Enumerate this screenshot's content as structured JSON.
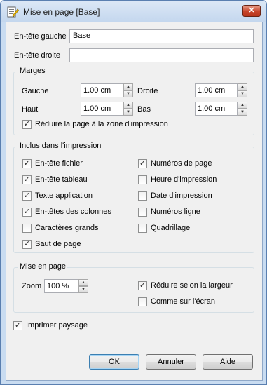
{
  "window": {
    "title": "Mise en page [Base]",
    "close_label": "✕"
  },
  "header": {
    "left_label": "En-tête gauche",
    "left_value": "Base",
    "right_label": "En-tête droite",
    "right_value": ""
  },
  "margins": {
    "title": "Marges",
    "left_label": "Gauche",
    "left_value": "1.00 cm",
    "right_label": "Droite",
    "right_value": "1.00 cm",
    "top_label": "Haut",
    "top_value": "1.00 cm",
    "bottom_label": "Bas",
    "bottom_value": "1.00 cm",
    "fit_label": "Réduire la page à la zone d'impression",
    "fit_checked": true
  },
  "include": {
    "title": "Inclus dans l'impression",
    "items": [
      {
        "label": "En-tête fichier",
        "checked": true
      },
      {
        "label": "En-tête tableau",
        "checked": true
      },
      {
        "label": "Texte application",
        "checked": true
      },
      {
        "label": "En-têtes des colonnes",
        "checked": true
      },
      {
        "label": "Caractères grands",
        "checked": false
      },
      {
        "label": "Saut de page",
        "checked": true
      },
      {
        "label": "Numéros de page",
        "checked": true
      },
      {
        "label": "Heure d'impression",
        "checked": false
      },
      {
        "label": "Date d'impression",
        "checked": false
      },
      {
        "label": "Numéros ligne",
        "checked": false
      },
      {
        "label": "Quadrillage",
        "checked": false
      }
    ]
  },
  "layout": {
    "title": "Mise en page",
    "zoom_label": "Zoom",
    "zoom_value": "100 %",
    "fit_width_label": "Réduire selon la largeur",
    "fit_width_checked": true,
    "as_screen_label": "Comme sur l'écran",
    "as_screen_checked": false
  },
  "landscape": {
    "label": "Imprimer paysage",
    "checked": true
  },
  "buttons": {
    "ok": "OK",
    "cancel": "Annuler",
    "help": "Aide"
  }
}
